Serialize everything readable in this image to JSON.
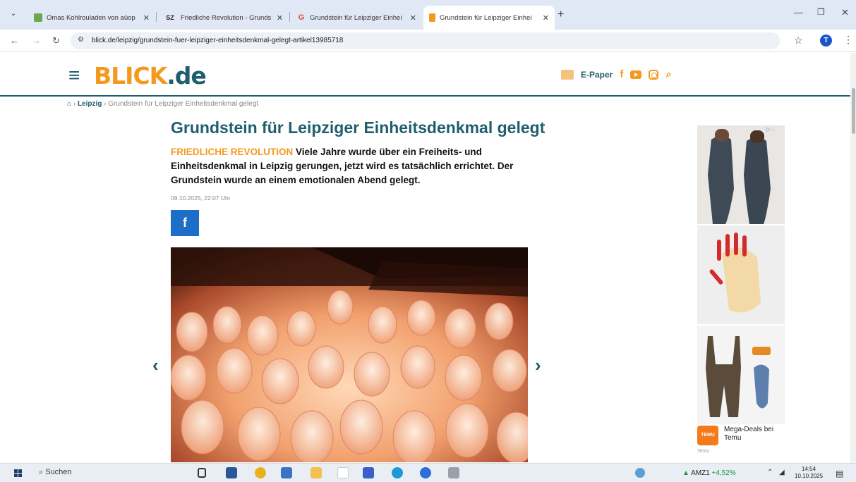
{
  "browser": {
    "tabs": [
      {
        "title": "Omas Kohlrouladen von aüop",
        "favicon": "green-jar"
      },
      {
        "title": "Friedliche Revolution - Grunds",
        "favicon": "SZ"
      },
      {
        "title": "Grundstein für Leipziger Einhei",
        "favicon": "G"
      },
      {
        "title": "Grundstein für Leipziger Einhei",
        "favicon": "orange-square",
        "active": true
      }
    ],
    "url": "blick.de/leipzig/grundstein-fuer-leipziger-einheitsdenkmal-gelegt-artikel13985718",
    "profile_initial": "T"
  },
  "site": {
    "logo_main": "BLICK",
    "logo_tld": ".de",
    "epaper_label": "E-Paper",
    "brand_color": "#f39a1e",
    "accent_color": "#1f5f6d"
  },
  "breadcrumb": {
    "section": "Leipzig",
    "current": "Grundstein für Leipziger Einheitsdenkmal gelegt"
  },
  "article": {
    "headline": "Grundstein für Leipziger Einheitsdenkmal gelegt",
    "kicker": "FRIEDLICHE REVOLUTION",
    "lead": "Viele Jahre wurde über ein Freiheits- und Einheitsdenkmal in Leipzig gerungen, jetzt wird es tatsächlich errichtet. Der Grundstein wurde an einem emotionalen Abend gelegt.",
    "date": "09.10.2025, 22:07 Uhr",
    "share_fb": "f"
  },
  "ad": {
    "title": "Mega-Deals bei Temu",
    "source": "Temu",
    "logo_text": "TEMU"
  },
  "taskbar": {
    "search": "Suchen",
    "stock_name": "AMZ1",
    "stock_change": "+4,52%",
    "time": "14:54",
    "date": "10.10.2025"
  }
}
